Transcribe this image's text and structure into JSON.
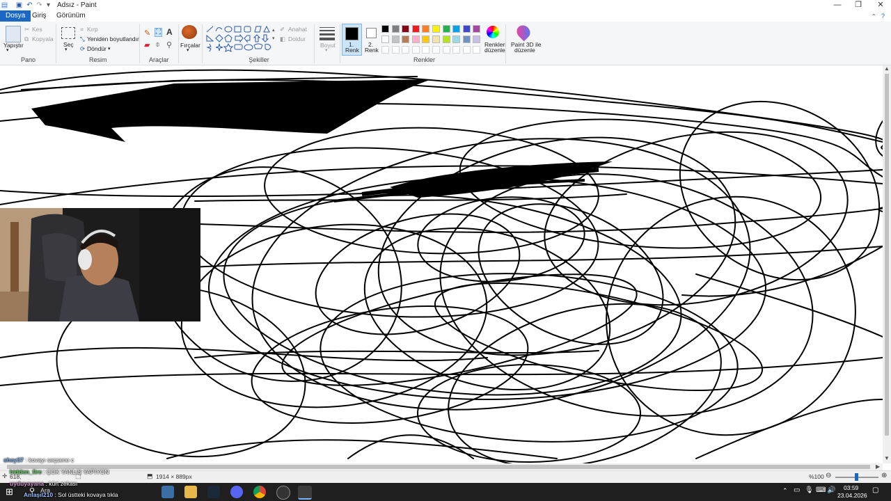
{
  "window": {
    "title": "Adsız - Paint"
  },
  "tabs": [
    "Dosya",
    "Giriş",
    "Görünüm"
  ],
  "ribbon": {
    "pano": {
      "label": "Pano",
      "paste": "Yapıştır",
      "cut": "Kes",
      "copy": "Kopyala"
    },
    "resim": {
      "label": "Resim",
      "select": "Seç",
      "crop": "Kırp",
      "resize": "Yeniden boyutlandır",
      "rotate": "Döndür"
    },
    "araclar": {
      "label": "Araçlar"
    },
    "fircalar": {
      "label": "Fırçalar"
    },
    "sekiller": {
      "label": "Şekiller",
      "outline": "Anahat",
      "fill": "Doldur"
    },
    "boyut": {
      "label": "Boyut"
    },
    "renkler": {
      "label": "Renkler",
      "color1_line1": "1.",
      "color1_line2": "Renk",
      "color2_line1": "2.",
      "color2_line2": "Renk",
      "edit_colors_line1": "Renkleri",
      "edit_colors_line2": "düzenle",
      "paint3d_line1": "Paint 3D ile",
      "paint3d_line2": "düzenle",
      "color1": "#000000",
      "color2": "#ffffff",
      "palette_row1": [
        "#000000",
        "#7f7f7f",
        "#880015",
        "#ed1c24",
        "#ff7f27",
        "#fff200",
        "#22b14c",
        "#00a2e8",
        "#3f48cc",
        "#a349a4"
      ],
      "palette_row2": [
        "#ffffff",
        "#c3c3c3",
        "#b97a57",
        "#ffaec9",
        "#ffc90e",
        "#efe4b0",
        "#b5e61d",
        "#99d9ea",
        "#7092be",
        "#c8bfe7"
      ]
    }
  },
  "status": {
    "cursor_pos": "618,",
    "canvas_size": "1914 × 889px",
    "zoom": "%100"
  },
  "taskbar": {
    "search": "Ara",
    "time": "03:59",
    "date": "23.04.2026"
  },
  "chat": [
    {
      "user": "shey37",
      "msg": ": kovayı seçsene c"
    },
    {
      "user": "hidden_fire",
      "msg": ": ÇOK YANLIŞ YAPIYON"
    },
    {
      "user": "uyduyayana",
      "msg": ": kürt zekası"
    },
    {
      "user": "Anlaşıl210",
      "msg": ": Sol üstteki kovaya tıkla"
    }
  ]
}
